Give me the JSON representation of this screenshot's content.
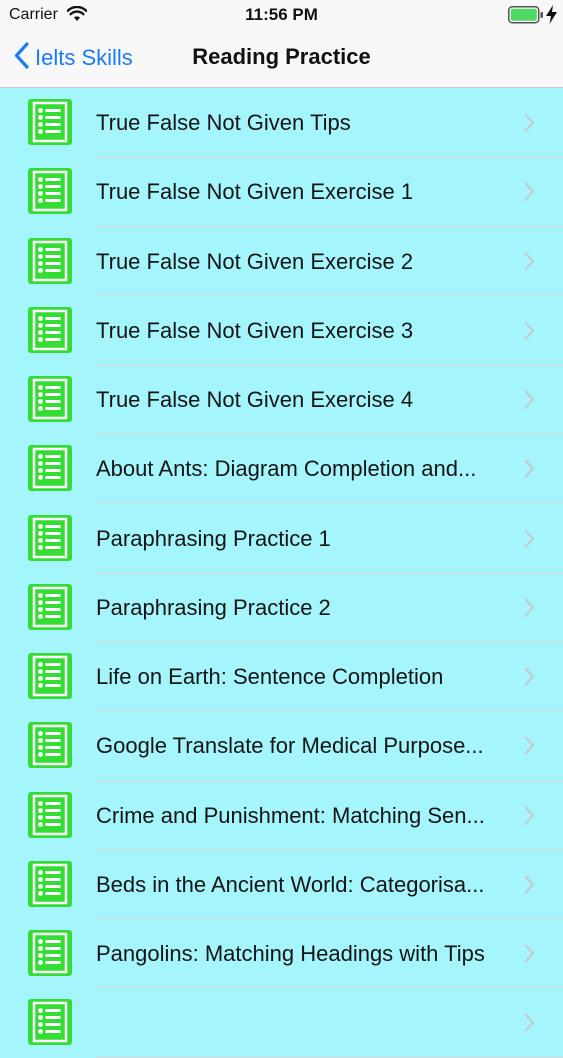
{
  "status_bar": {
    "carrier": "Carrier",
    "time": "11:56 PM",
    "battery_color": "#4cd964"
  },
  "nav": {
    "back_label": "Ielts Skills",
    "title": "Reading Practice",
    "accent_color": "#1a7cf5"
  },
  "list": {
    "background_color": "#a5f5fd",
    "icon_name": "checklist-icon",
    "icon_color": "#33dd33",
    "items": [
      {
        "label": "True False Not Given Tips"
      },
      {
        "label": "True False Not Given Exercise 1"
      },
      {
        "label": "True False Not Given Exercise 2"
      },
      {
        "label": "True False Not Given Exercise 3"
      },
      {
        "label": "True False Not Given Exercise 4"
      },
      {
        "label": "About Ants: Diagram Completion and..."
      },
      {
        "label": "Paraphrasing Practice 1"
      },
      {
        "label": "Paraphrasing Practice 2"
      },
      {
        "label": "Life on Earth: Sentence Completion"
      },
      {
        "label": "Google Translate for Medical Purpose..."
      },
      {
        "label": "Crime and Punishment: Matching Sen..."
      },
      {
        "label": "Beds in the Ancient World: Categorisa..."
      },
      {
        "label": "Pangolins: Matching Headings with Tips"
      },
      {
        "label": ""
      }
    ]
  }
}
